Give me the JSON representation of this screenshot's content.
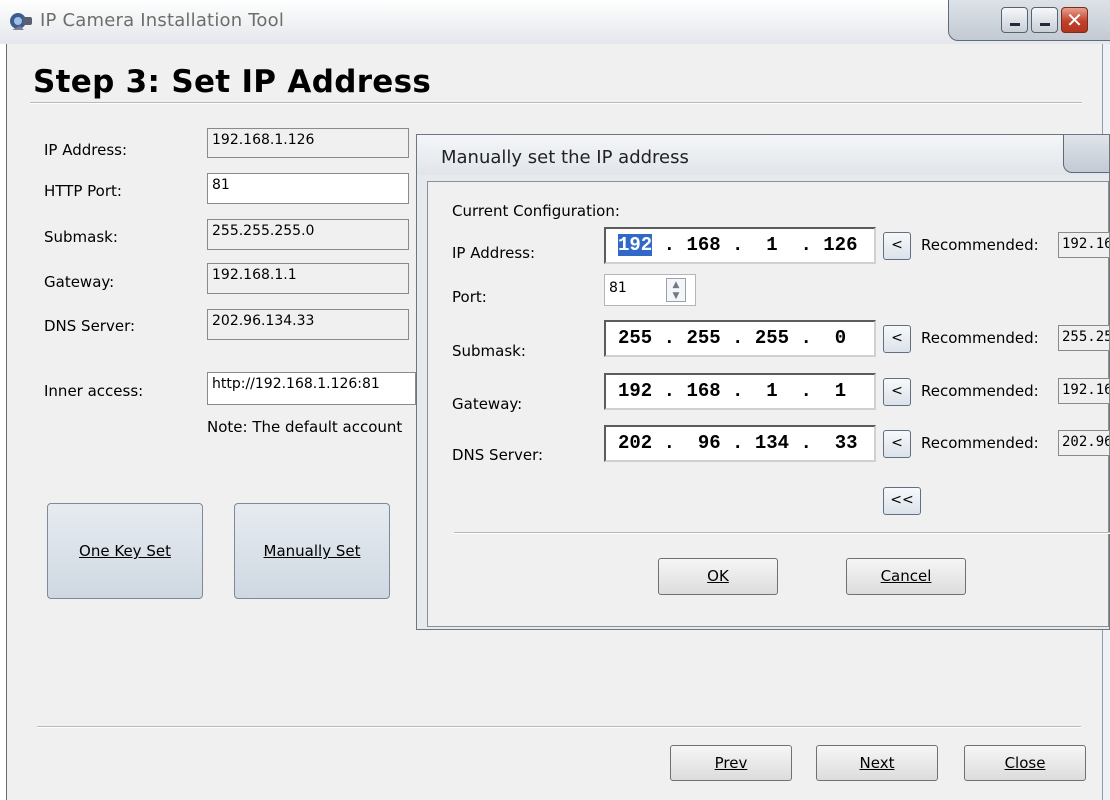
{
  "window": {
    "title": "IP Camera Installation Tool"
  },
  "step_title": "Step 3: Set IP Address",
  "fields": [
    {
      "label": "IP Address:",
      "value": "192.168.1.126"
    },
    {
      "label": "HTTP Port:",
      "value": "81"
    },
    {
      "label": "Submask:",
      "value": "255.255.255.0"
    },
    {
      "label": "Gateway:",
      "value": "192.168.1.1"
    },
    {
      "label": "DNS Server:",
      "value": "202.96.134.33"
    }
  ],
  "inner_access": {
    "label": "Inner access:",
    "value": "http://192.168.1.126:81"
  },
  "note": "Note: The default account",
  "buttons": {
    "one_key_set": "One Key Set",
    "manually_set": "Manually Set",
    "prev": "Prev",
    "next": "Next",
    "close": "Close"
  },
  "dialog": {
    "title": "Manually set the IP address",
    "section_label": "Current Configuration:",
    "ip": {
      "label": "IP Address:",
      "octets": [
        "192",
        "168",
        "1",
        "126"
      ],
      "selected_octet": "192"
    },
    "port": {
      "label": "Port:",
      "value": "81"
    },
    "submask": {
      "label": "Submask:",
      "octets": [
        "255",
        "255",
        "255",
        "0"
      ]
    },
    "gateway": {
      "label": "Gateway:",
      "octets": [
        "192",
        "168",
        "1",
        "1"
      ]
    },
    "dns": {
      "label": "DNS Server:",
      "octets": [
        "202",
        "96",
        "134",
        "33"
      ]
    },
    "recommended_label": "Recommended:",
    "recommended": {
      "ip": "192.16",
      "submask": "255.25",
      "gateway": "192.16",
      "dns": "202.96"
    },
    "copy_button": "<",
    "collapse_button": "<<",
    "ok": "OK",
    "cancel": "Cancel"
  },
  "colors": {
    "selection": "#3169c6",
    "close_button": "#c1412a"
  }
}
